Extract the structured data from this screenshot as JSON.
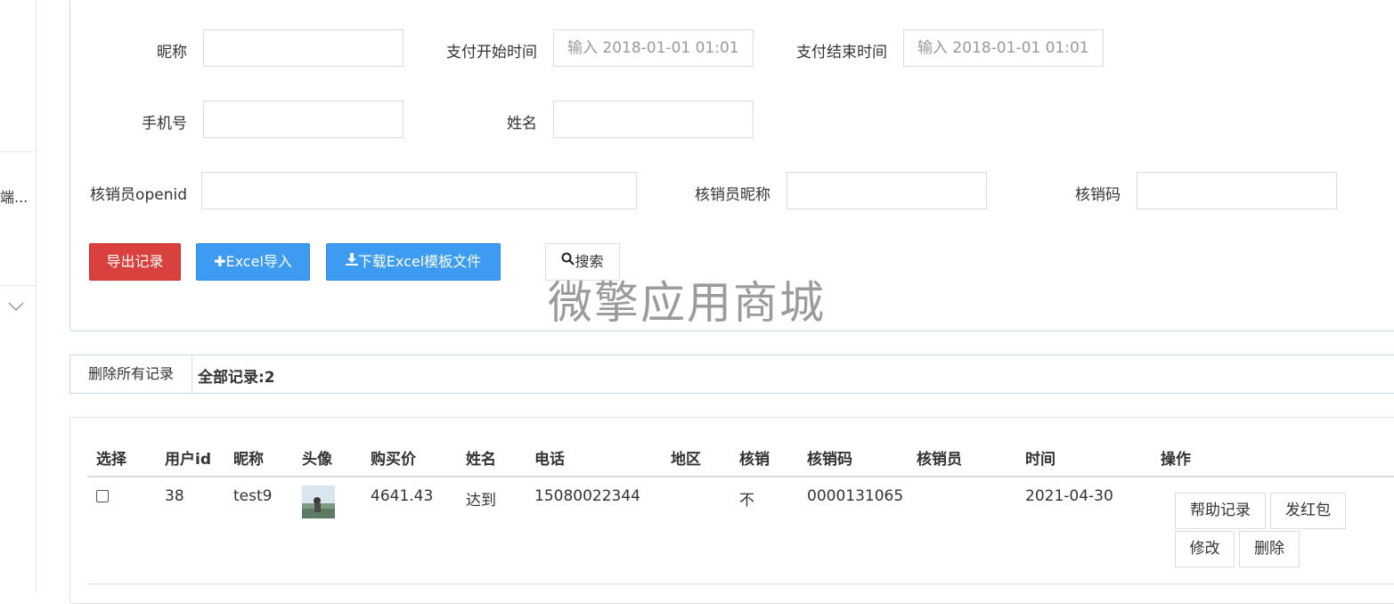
{
  "sidebar": {
    "truncated_item": "端...",
    "chevron": "﹀"
  },
  "search": {
    "nickname": {
      "label": "昵称",
      "value": ""
    },
    "pay_start": {
      "label": "支付开始时间",
      "placeholder": "输入 2018-01-01 01:01"
    },
    "pay_end": {
      "label": "支付结束时间",
      "placeholder": "输入 2018-01-01 01:01"
    },
    "phone": {
      "label": "手机号",
      "value": ""
    },
    "name": {
      "label": "姓名",
      "value": ""
    },
    "verifier_openid": {
      "label": "核销员openid",
      "value": ""
    },
    "verifier_nickname": {
      "label": "核销员昵称",
      "value": ""
    },
    "verify_code": {
      "label": "核销码",
      "value": ""
    }
  },
  "actions": {
    "export": "导出记录",
    "excel_import": "Excel导入",
    "download_template": "下载Excel模板文件",
    "search": "搜索"
  },
  "watermark": "微擎应用商城",
  "records": {
    "delete_all": "删除所有记录",
    "total": "全部记录:2"
  },
  "table": {
    "headers": [
      "选择",
      "用户id",
      "昵称",
      "头像",
      "购买价",
      "姓名",
      "电话",
      "地区",
      "核销",
      "核销码",
      "核销员",
      "时间",
      "操作"
    ],
    "rows": [
      {
        "user_id": "38",
        "nickname": "test9",
        "price": "4641.43",
        "name": "达到",
        "phone": "15080022344",
        "region": "",
        "verified": "不",
        "code": "0000131065",
        "verifier": "",
        "time": "2021-04-30",
        "ops": [
          "帮助记录",
          "发红包",
          "修改",
          "删除"
        ]
      }
    ]
  },
  "colors": {
    "danger": "#d9413e",
    "primary": "#3d9cf1",
    "border": "#bfdbe8"
  },
  "icons": {
    "plus": "plus-icon",
    "download": "download-icon",
    "search": "search-icon"
  }
}
